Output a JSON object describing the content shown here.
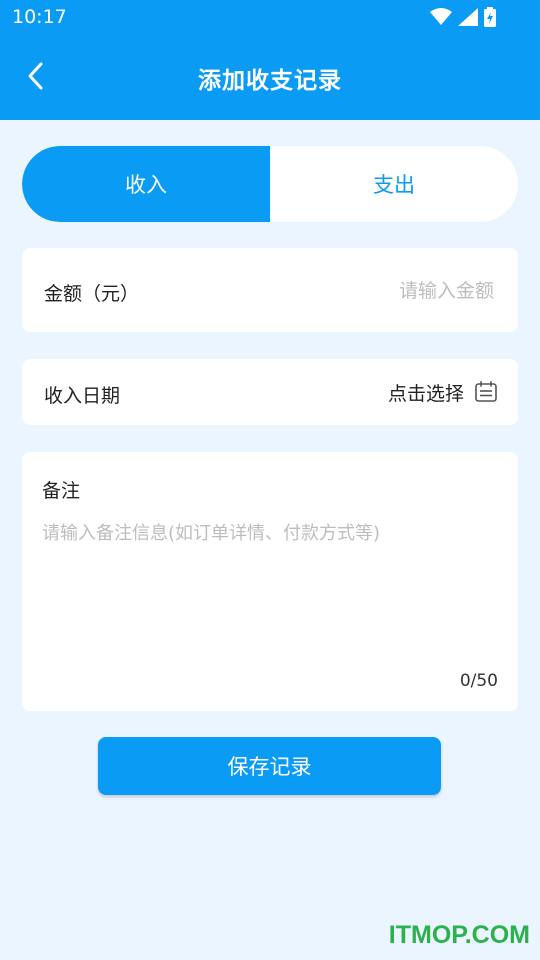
{
  "status_bar": {
    "time": "10:17",
    "icons": [
      "wifi-icon",
      "signal-icon",
      "battery-charging-icon"
    ]
  },
  "header": {
    "title": "添加收支记录",
    "back_icon": "chevron-left-icon"
  },
  "tabs": [
    {
      "label": "收入",
      "active": true
    },
    {
      "label": "支出",
      "active": false
    }
  ],
  "amount": {
    "label": "金额（元）",
    "placeholder": "请输入金额",
    "value": ""
  },
  "date": {
    "label": "收入日期",
    "value": "点击选择",
    "icon": "calendar-icon"
  },
  "note": {
    "label": "备注",
    "placeholder": "请输入备注信息(如订单详情、付款方式等)",
    "value": "",
    "counter": "0/50"
  },
  "save_button": {
    "label": "保存记录"
  },
  "watermark": "ITMOP.COM",
  "colors": {
    "primary": "#0A9BF5",
    "background": "#EBF5FF",
    "placeholder": "#BDBDBD",
    "watermark": "#2BB24C"
  }
}
